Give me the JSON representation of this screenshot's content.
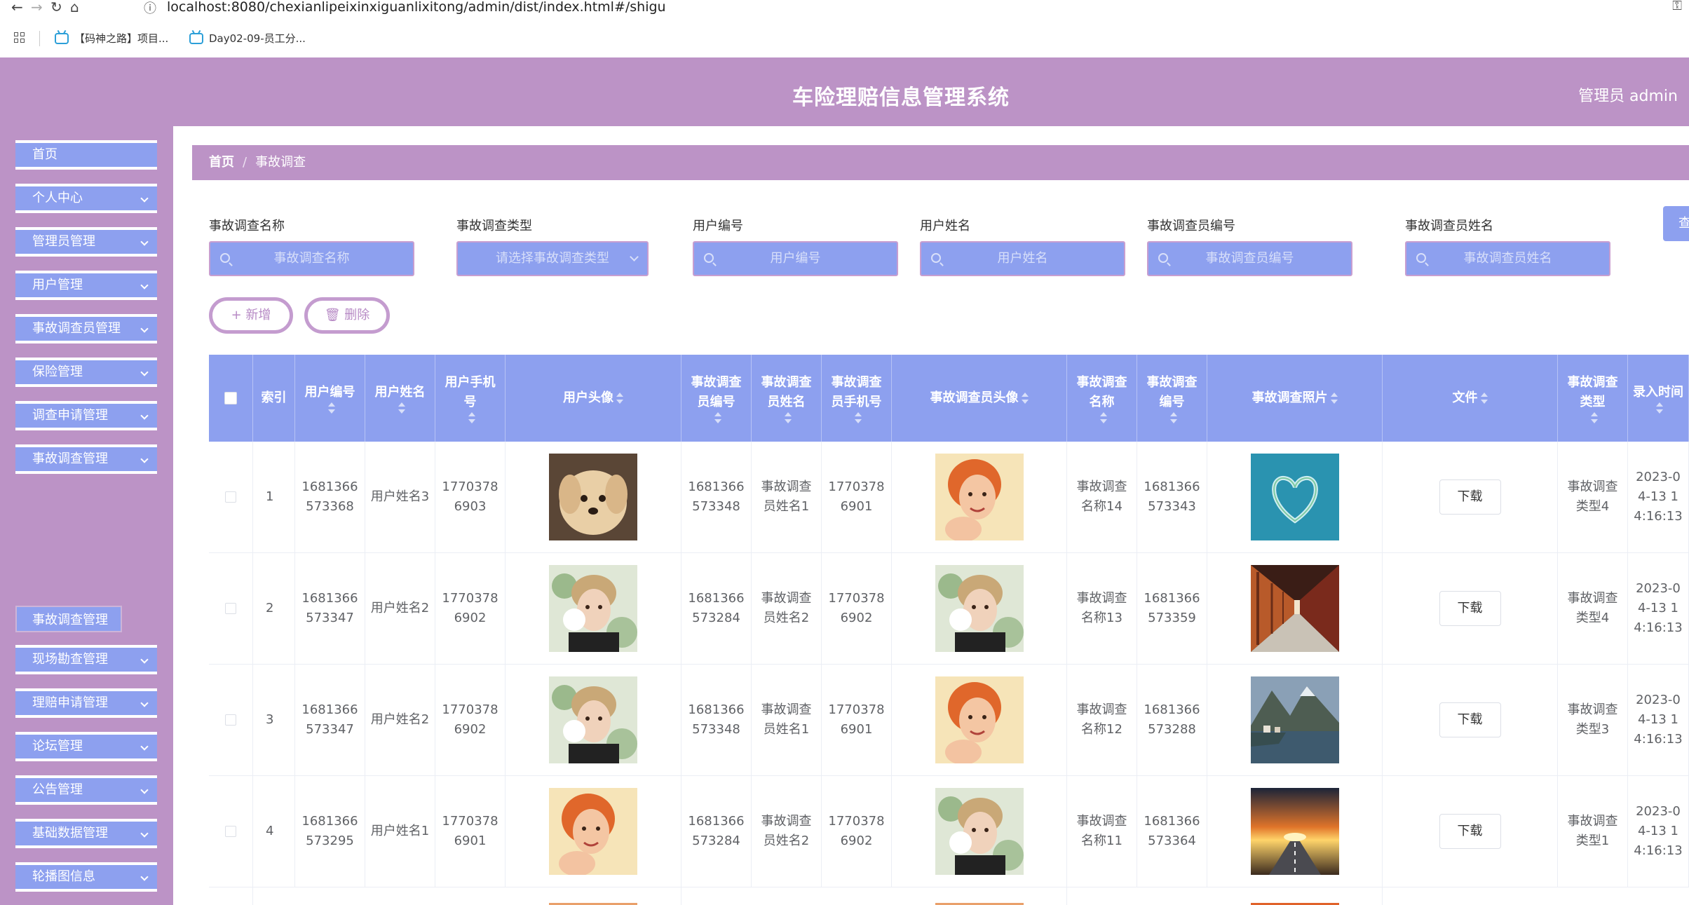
{
  "browser": {
    "url": "localhost:8080/chexianlipeixinxiguanlixitong/admin/dist/index.html#/shigu",
    "bookmarks": [
      "【码神之路】项目...",
      "Day02-09-员工分..."
    ]
  },
  "header": {
    "title": "车险理赔信息管理系统",
    "user": "管理员 admin"
  },
  "sidebar": {
    "items": [
      "首页",
      "个人中心",
      "管理员管理",
      "用户管理",
      "事故调查员管理",
      "保险管理",
      "调查申请管理",
      "事故调查管理",
      "现场勘查管理",
      "理赔申请管理",
      "论坛管理",
      "公告管理",
      "基础数据管理",
      "轮播图信息"
    ],
    "active_sub": "事故调查管理"
  },
  "breadcrumb": {
    "home": "首页",
    "separator": "/",
    "current": "事故调查"
  },
  "search": {
    "fields": [
      {
        "label": "事故调查名称",
        "placeholder": "事故调查名称"
      },
      {
        "label": "事故调查类型",
        "placeholder": "请选择事故调查类型"
      },
      {
        "label": "用户编号",
        "placeholder": "用户编号"
      },
      {
        "label": "用户姓名",
        "placeholder": "用户姓名"
      },
      {
        "label": "事故调查员编号",
        "placeholder": "事故调查员编号"
      },
      {
        "label": "事故调查员姓名",
        "placeholder": "事故调查员姓名"
      }
    ],
    "query_label": "查"
  },
  "actions": {
    "add": "+ 新增",
    "delete": "删除"
  },
  "table": {
    "headers": [
      "索引",
      "用户编号",
      "用户姓名",
      "用户手机号",
      "用户头像",
      "事故调查员编号",
      "事故调查员姓名",
      "事故调查员手机号",
      "事故调查员头像",
      "事故调查名称",
      "事故调查编号",
      "事故调查照片",
      "文件",
      "事故调查类型",
      "录入时间"
    ],
    "download_label": "下载",
    "rows": [
      {
        "index": "1",
        "user_no": "1681366573368",
        "user_name": "用户姓名3",
        "user_phone": "17703786903",
        "user_avatar": "puppy",
        "inv_no": "1681366573348",
        "inv_name": "事故调查员姓名1",
        "inv_phone": "17703786901",
        "inv_avatar": "woman",
        "acc_name": "事故调查名称14",
        "acc_no": "1681366573343",
        "photo": "heart-island",
        "acc_type": "事故调查类型4",
        "time": "2023-04-13 14:16:13"
      },
      {
        "index": "2",
        "user_no": "1681366573347",
        "user_name": "用户姓名2",
        "user_phone": "17703786902",
        "user_avatar": "man",
        "inv_no": "1681366573284",
        "inv_name": "事故调查员姓名2",
        "inv_phone": "17703786902",
        "inv_avatar": "man",
        "acc_name": "事故调查名称13",
        "acc_no": "1681366573359",
        "photo": "corridor",
        "acc_type": "事故调查类型4",
        "time": "2023-04-13 14:16:13"
      },
      {
        "index": "3",
        "user_no": "1681366573347",
        "user_name": "用户姓名2",
        "user_phone": "17703786902",
        "user_avatar": "man",
        "inv_no": "1681366573348",
        "inv_name": "事故调查员姓名1",
        "inv_phone": "17703786901",
        "inv_avatar": "woman",
        "acc_name": "事故调查名称12",
        "acc_no": "1681366573288",
        "photo": "lake-village",
        "acc_type": "事故调查类型3",
        "time": "2023-04-13 14:16:13"
      },
      {
        "index": "4",
        "user_no": "1681366573295",
        "user_name": "用户姓名1",
        "user_phone": "17703786901",
        "user_avatar": "woman",
        "inv_no": "1681366573284",
        "inv_name": "事故调查员姓名2",
        "inv_phone": "17703786902",
        "inv_avatar": "man",
        "acc_name": "事故调查名称11",
        "acc_no": "1681366573364",
        "photo": "sunset-road",
        "acc_type": "事故调查类型1",
        "time": "2023-04-13 14:16:13"
      }
    ]
  },
  "colors": {
    "header_bg": "#bc93c6",
    "menu_bg": "#8da0ef",
    "table_header_bg": "#8da0ef"
  }
}
